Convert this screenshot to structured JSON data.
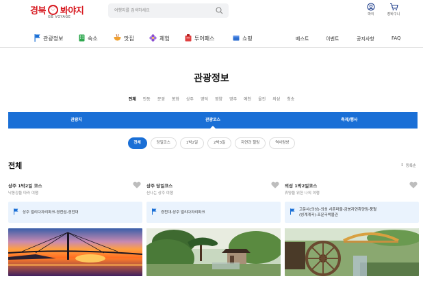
{
  "header": {
    "logo_text_left": "경북",
    "logo_text_right": "봐야지",
    "logo_sub": "GB VOYAGE",
    "search_placeholder": "여행지를 검색하세요",
    "mypage_label": "마이",
    "cart_label": "장바구니"
  },
  "nav": {
    "items": [
      {
        "label": "관광정보",
        "icon": "flag-icon",
        "color": "#1a6fd6"
      },
      {
        "label": "숙소",
        "icon": "building-icon",
        "color": "#2fa84f"
      },
      {
        "label": "맛집",
        "icon": "bowl-icon",
        "color": "#f0a030"
      },
      {
        "label": "체험",
        "icon": "flower-icon",
        "color": "#8a4fd0"
      },
      {
        "label": "투어패스",
        "icon": "ticket-icon",
        "color": "#e04040"
      },
      {
        "label": "쇼핑",
        "icon": "bag-icon",
        "color": "#2f6fd0"
      }
    ],
    "links": [
      "베스트",
      "이벤트",
      "공지사항",
      "FAQ"
    ]
  },
  "page": {
    "title": "관광정보",
    "regions": [
      "전체",
      "안동",
      "문경",
      "봉화",
      "상주",
      "영덕",
      "영양",
      "영주",
      "예천",
      "울진",
      "의성",
      "청송"
    ],
    "active_region": "전체"
  },
  "tabs": {
    "items": [
      "관광지",
      "관광코스",
      "축제/행사"
    ],
    "active": "관광코스"
  },
  "chips": {
    "items": [
      "전체",
      "당일코스",
      "1박2일",
      "2박3일",
      "자연과 힐링",
      "역사탐방"
    ],
    "active": "전체"
  },
  "section": {
    "title": "전체",
    "sort_label": "등록순"
  },
  "cards": [
    {
      "title": "상주 1박2일 코스",
      "subtitle": "낙동강을 따라 여행",
      "route": "상주 얼리다자리파크-경천섬-경천대"
    },
    {
      "title": "상주 당일코스",
      "subtitle": "신나는 상주 여행",
      "route": "경천대-상주 얼리다자리파크"
    },
    {
      "title": "의성 1박2일코스",
      "subtitle": "휴양을 위한 나의 여행",
      "route_line1": "고운사(의성)-의성 사촌마을-금봉자연휴양림-풍혈",
      "route_line2": "(빙계계곡)-조문국박물관"
    }
  ],
  "colors": {
    "brand_red": "#d71920",
    "accent_blue": "#1a6fd6",
    "route_bg": "#eaf3fd"
  }
}
